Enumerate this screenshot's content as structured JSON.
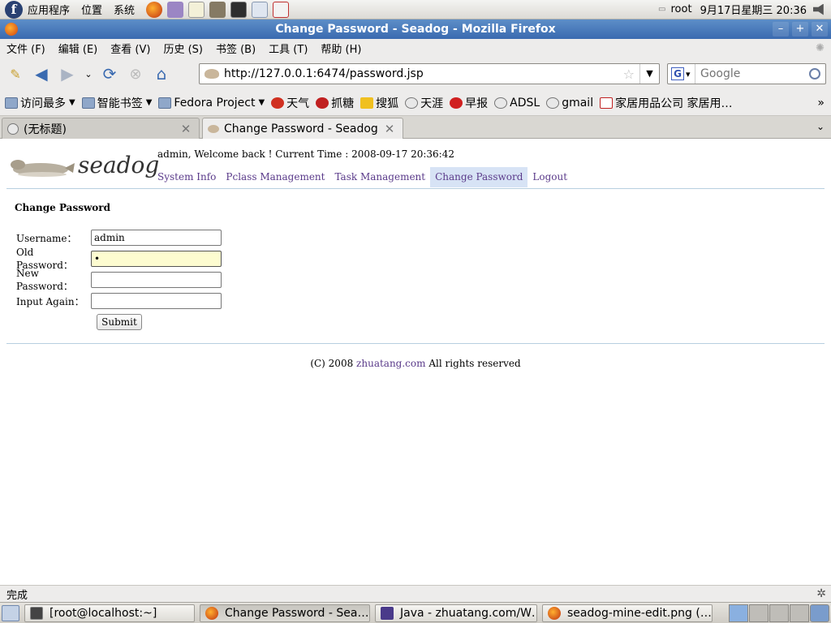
{
  "top_panel": {
    "menus": [
      "应用程序",
      "位置",
      "系统"
    ],
    "user": "root",
    "datetime": "9月17日星期三 20:36"
  },
  "window": {
    "title": "Change Password - Seadog - Mozilla Firefox"
  },
  "menubar": {
    "items": [
      "文件 (F)",
      "编辑 (E)",
      "查看 (V)",
      "历史 (S)",
      "书签 (B)",
      "工具 (T)",
      "帮助 (H)"
    ]
  },
  "navbar": {
    "url": "http://127.0.0.1:6474/password.jsp",
    "search_placeholder": "Google"
  },
  "bookmarks": {
    "items": [
      "访问最多",
      "智能书签",
      "Fedora Project",
      "天气",
      "抓糖",
      "搜狐",
      "天涯",
      "早报",
      "ADSL",
      "gmail",
      "家居用品公司 家居用…"
    ],
    "overflow": "»"
  },
  "tabs": [
    {
      "label": "(无标题)"
    },
    {
      "label": "Change Password - Seadog"
    }
  ],
  "page": {
    "logo_text": "seadog",
    "welcome": "admin, Welcome back ! Current Time : 2008-09-17 20:36:42",
    "nav": [
      "System Info",
      "Pclass Management",
      "Task Management",
      "Change Password",
      "Logout"
    ],
    "section_title": "Change Password",
    "form": {
      "username_label": "Username：",
      "username_value": "admin",
      "old_password_label": "Old Password：",
      "old_password_value": "•",
      "new_password_label": "New Password：",
      "new_password_value": "",
      "input_again_label": "Input Again：",
      "input_again_value": "",
      "submit_label": "Submit"
    },
    "footer": {
      "prefix": "(C) 2008",
      "link": "zhuatang.com",
      "suffix": "All rights reserved"
    }
  },
  "statusbar": {
    "text": "完成"
  },
  "taskbar": {
    "tasks": [
      "[root@localhost:~]",
      "Change Password - Sea…",
      "Java - zhuatang.com/W…",
      "seadog-mine-edit.png (…"
    ]
  },
  "colors": {
    "link": "#5a3a8a",
    "active_nav_bg": "#d7e3f5",
    "focused_input_bg": "#fdfcd0",
    "titlebar": "#4a7cc0"
  }
}
